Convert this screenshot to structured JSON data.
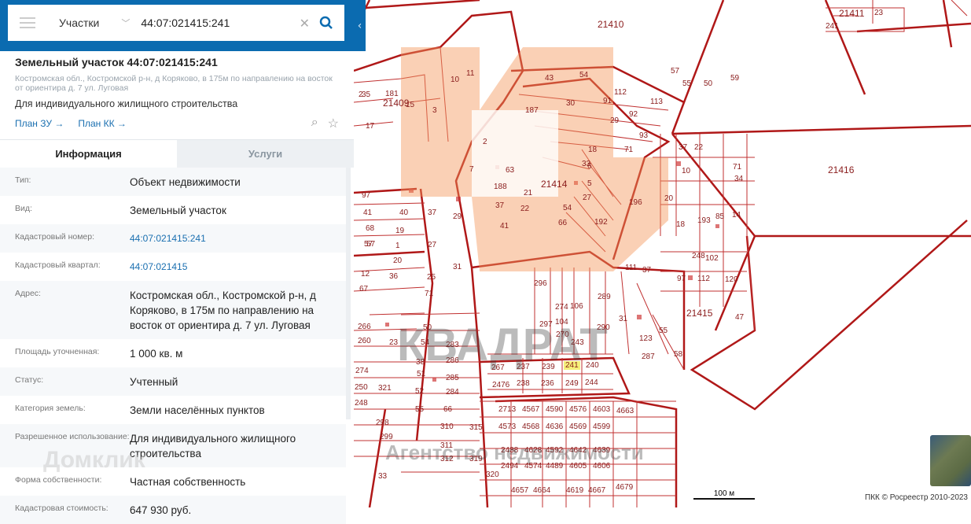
{
  "search": {
    "type": "Участки",
    "query": "44:07:021415:241"
  },
  "card": {
    "title": "Земельный участок 44:07:021415:241",
    "address": "Костромская обл., Костромской р-н, д Коряково, в 175м по направлению на восток от ориентира д. 7 ул. Луговая",
    "purpose": "Для индивидуального жилищного строительства",
    "link1": "План ЗУ →",
    "link2": "План КК →"
  },
  "tabs": {
    "info": "Информация",
    "services": "Услуги"
  },
  "rows": [
    {
      "label": "Тип:",
      "value": "Объект недвижимости"
    },
    {
      "label": "Вид:",
      "value": "Земельный участок"
    },
    {
      "label": "Кадастровый номер:",
      "value": "44:07:021415:241"
    },
    {
      "label": "Кадастровый квартал:",
      "value": "44:07:021415"
    },
    {
      "label": "Адрес:",
      "value": "Костромская обл., Костромской р-н, д Коряково, в 175м по направлению на восток от ориентира д. 7 ул. Луговая"
    },
    {
      "label": "Площадь уточненная:",
      "value": "1 000 кв. м"
    },
    {
      "label": "Статус:",
      "value": "Учтенный"
    },
    {
      "label": "Категория земель:",
      "value": "Земли населённых пунктов"
    },
    {
      "label": "Разрешенное использование:",
      "value": "Для индивидуального жилищного строительства"
    },
    {
      "label": "Форма собственности:",
      "value": "Частная собственность"
    },
    {
      "label": "Кадастровая стоимость:",
      "value": "647 930 руб."
    }
  ],
  "watermarks": {
    "domclick": "Домклик",
    "kvadrat": "КВАДРАТ",
    "agency": "Агентство недвижимости"
  },
  "map": {
    "blocks": [
      "21410",
      "21409",
      "21411",
      "21416",
      "21414",
      "21415",
      "21411"
    ],
    "selected": "241",
    "parcels": [
      "43",
      "54",
      "57",
      "55",
      "50",
      "59",
      "91",
      "112",
      "113",
      "187",
      "30",
      "29",
      "92",
      "93",
      "18",
      "33",
      "71",
      "37",
      "22",
      "6",
      "5",
      "27",
      "54",
      "66",
      "192",
      "196",
      "20",
      "18",
      "193",
      "85",
      "14",
      "71",
      "34",
      "10",
      "63",
      "21",
      "188",
      "37",
      "22",
      "7",
      "2",
      "40",
      "41",
      "29",
      "37",
      "27",
      "19",
      "57",
      "20",
      "36",
      "25",
      "71",
      "31",
      "12",
      "67",
      "1",
      "50",
      "54",
      "283",
      "286",
      "285",
      "284",
      "66",
      "55",
      "52",
      "51",
      "38",
      "23",
      "260",
      "266",
      "274",
      "250",
      "248",
      "321",
      "298",
      "299",
      "310",
      "315",
      "311",
      "312",
      "319",
      "320",
      "33",
      "296",
      "274",
      "104",
      "106",
      "289",
      "290",
      "31",
      "123",
      "287",
      "55",
      "58",
      "97",
      "112",
      "120",
      "248",
      "102",
      "111",
      "37",
      "47",
      "297",
      "270",
      "243",
      "267",
      "237",
      "239",
      "240",
      "249",
      "244",
      "2476",
      "238",
      "236",
      "2713",
      "4567",
      "4590",
      "4576",
      "4603",
      "4663",
      "4573",
      "4568",
      "4636",
      "4569",
      "4599",
      "2438",
      "4628",
      "4592",
      "4642",
      "4639",
      "2494",
      "4574",
      "4489",
      "4605",
      "4606",
      "4657",
      "4664",
      "4619",
      "4667",
      "4679",
      "23",
      "241",
      "35",
      "181",
      "17",
      "15",
      "3",
      "10",
      "11",
      "2",
      "97",
      "41",
      "68",
      "57"
    ]
  },
  "scale": "100 м",
  "attribution": "ПКК © Росреестр 2010-2023"
}
